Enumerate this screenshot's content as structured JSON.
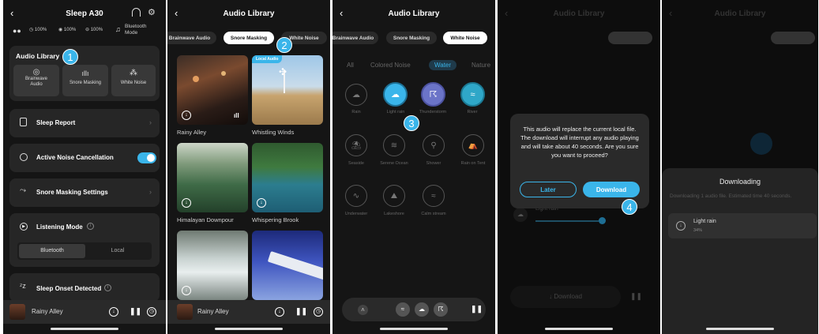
{
  "screen1": {
    "title": "Sleep A30",
    "battery_left": "100%",
    "battery_right": "100%",
    "battery_case": "100%",
    "mode_label": "Bluetooth Mode",
    "audio_library_label": "Audio Library",
    "audio_items": [
      "Brainwave Audio",
      "Snore Masking",
      "White Noise"
    ],
    "sleep_report": "Sleep Report",
    "anc_label": "Active Noise Cancellation",
    "anc_on": true,
    "snore_settings": "Snore Masking Settings",
    "listening_mode": "Listening Mode",
    "mode_options": [
      "Bluetooth",
      "Local"
    ],
    "sleep_onset": "Sleep Onset Detected",
    "now_playing": "Rainy Alley",
    "step": "1"
  },
  "screen2": {
    "title": "Audio Library",
    "tabs": [
      "Brainwave Audio",
      "Snore Masking",
      "White Noise"
    ],
    "local_audio_tag": "Local Audio",
    "items": [
      "Rainy Alley",
      "Whistling Winds",
      "Himalayan Downpour",
      "Whispering Brook"
    ],
    "now_playing": "Rainy Alley",
    "step": "2"
  },
  "screen3": {
    "title": "Audio Library",
    "tabs": [
      "Brainwave Audio",
      "Snore Masking",
      "White Noise"
    ],
    "categories": [
      "All",
      "Colored Noise",
      "Water",
      "Nature"
    ],
    "sounds": [
      "Rain",
      "Light rain",
      "Thunderstorm",
      "River",
      "Seaside",
      "Serene Ocean",
      "Shower",
      "Rain on Tent",
      "Underwater",
      "Lakeshore",
      "Calm stream"
    ],
    "step": "3"
  },
  "screen4": {
    "title": "Audio Library",
    "dialog_text": "This audio will replace the current local file. The download will interrupt any audio playing and will take about 40 seconds. Are you sure you want to proceed?",
    "later": "Later",
    "download": "Download",
    "bg_item": "Light rain",
    "bg_download": "Download",
    "step": "4"
  },
  "screen5": {
    "title": "Audio Library",
    "sheet_title": "Downloading",
    "sheet_desc": "Downloading 1 audio file. Estimated time 40 seconds.",
    "item_name": "Light rain",
    "item_progress": "34%"
  },
  "colors": {
    "accent": "#3ab5ea",
    "bg": "#151515",
    "card": "#262626"
  }
}
